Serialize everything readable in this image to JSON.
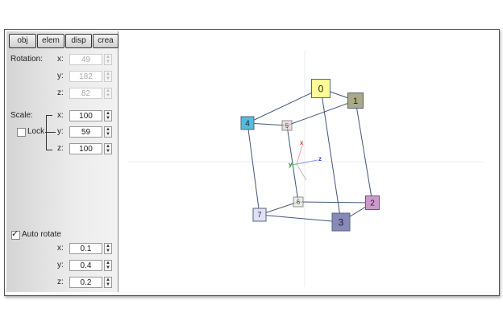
{
  "tabs": [
    {
      "label": "obj"
    },
    {
      "label": "elem"
    },
    {
      "label": "disp"
    },
    {
      "label": "crea"
    }
  ],
  "rotation": {
    "label": "Rotation:",
    "x_label": "x:",
    "y_label": "y:",
    "z_label": "z:",
    "x": "49",
    "y": "182",
    "z": "82"
  },
  "scale": {
    "label": "Scale:",
    "lock_label": "Lock",
    "lock_checked": false,
    "x_label": "x:",
    "y_label": "y:",
    "z_label": "z:",
    "x": "100",
    "y": "59",
    "z": "100"
  },
  "auto_rotate": {
    "label": "Auto rotate",
    "checked": true,
    "x_label": "x:",
    "y_label": "y:",
    "z_label": "z:",
    "x": "0.1",
    "y": "0.4",
    "z": "0.2"
  },
  "scene": {
    "axis_labels": {
      "x": "x",
      "y": "y",
      "z": "z"
    },
    "nodes": [
      {
        "label": "0",
        "color": "#ffff99"
      },
      {
        "label": "1",
        "color": "#aaaa88"
      },
      {
        "label": "2",
        "color": "#cc99cc"
      },
      {
        "label": "3",
        "color": "#8888bb"
      },
      {
        "label": "4",
        "color": "#55bbdd"
      },
      {
        "label": "5",
        "color": "#e8cfc8"
      },
      {
        "label": "6",
        "color": "#e6e6d6"
      },
      {
        "label": "7",
        "color": "#e0e0f8"
      }
    ]
  }
}
